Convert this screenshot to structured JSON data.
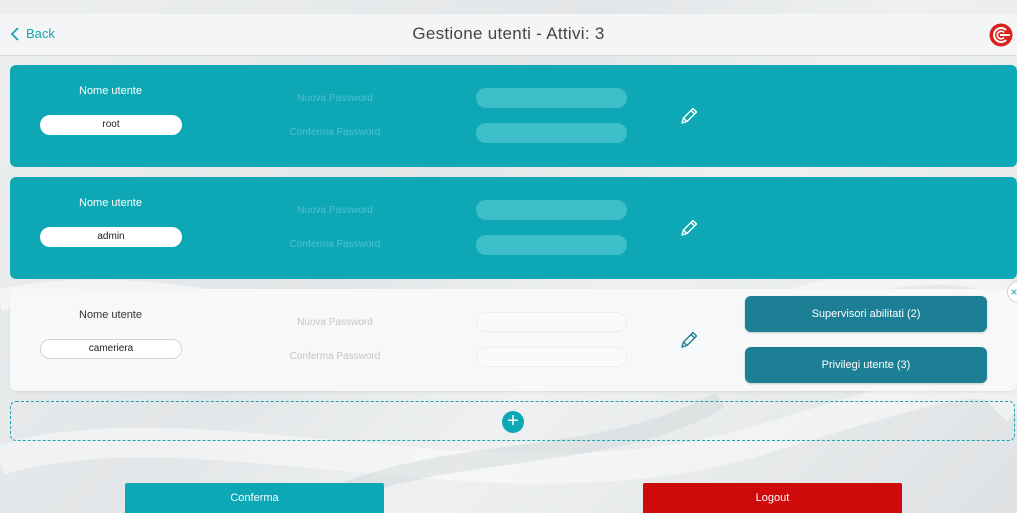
{
  "header": {
    "back_label": "Back",
    "title": "Gestione utenti - Attivi: 3"
  },
  "users": [
    {
      "name_label": "Nome utente",
      "username": "root",
      "new_password_label": "Nuova Password",
      "confirm_password_label": "Conferma Password"
    },
    {
      "name_label": "Nome utente",
      "username": "admin",
      "new_password_label": "Nuova Password",
      "confirm_password_label": "Conferma Password"
    },
    {
      "name_label": "Nome utente",
      "username": "cameriera",
      "new_password_label": "Nuova Password",
      "confirm_password_label": "Conferma Password",
      "supervisors_button": "Supervisori abilitati (2)",
      "privileges_button": "Privilegi utente (3)"
    }
  ],
  "actions": {
    "add_symbol": "+",
    "close_symbol": "×",
    "confirm_label": "Conferma",
    "logout_label": "Logout"
  },
  "colors": {
    "accent": "#0ea7b5",
    "button_dark": "#1c7f95",
    "logout": "#cf0a0a"
  }
}
